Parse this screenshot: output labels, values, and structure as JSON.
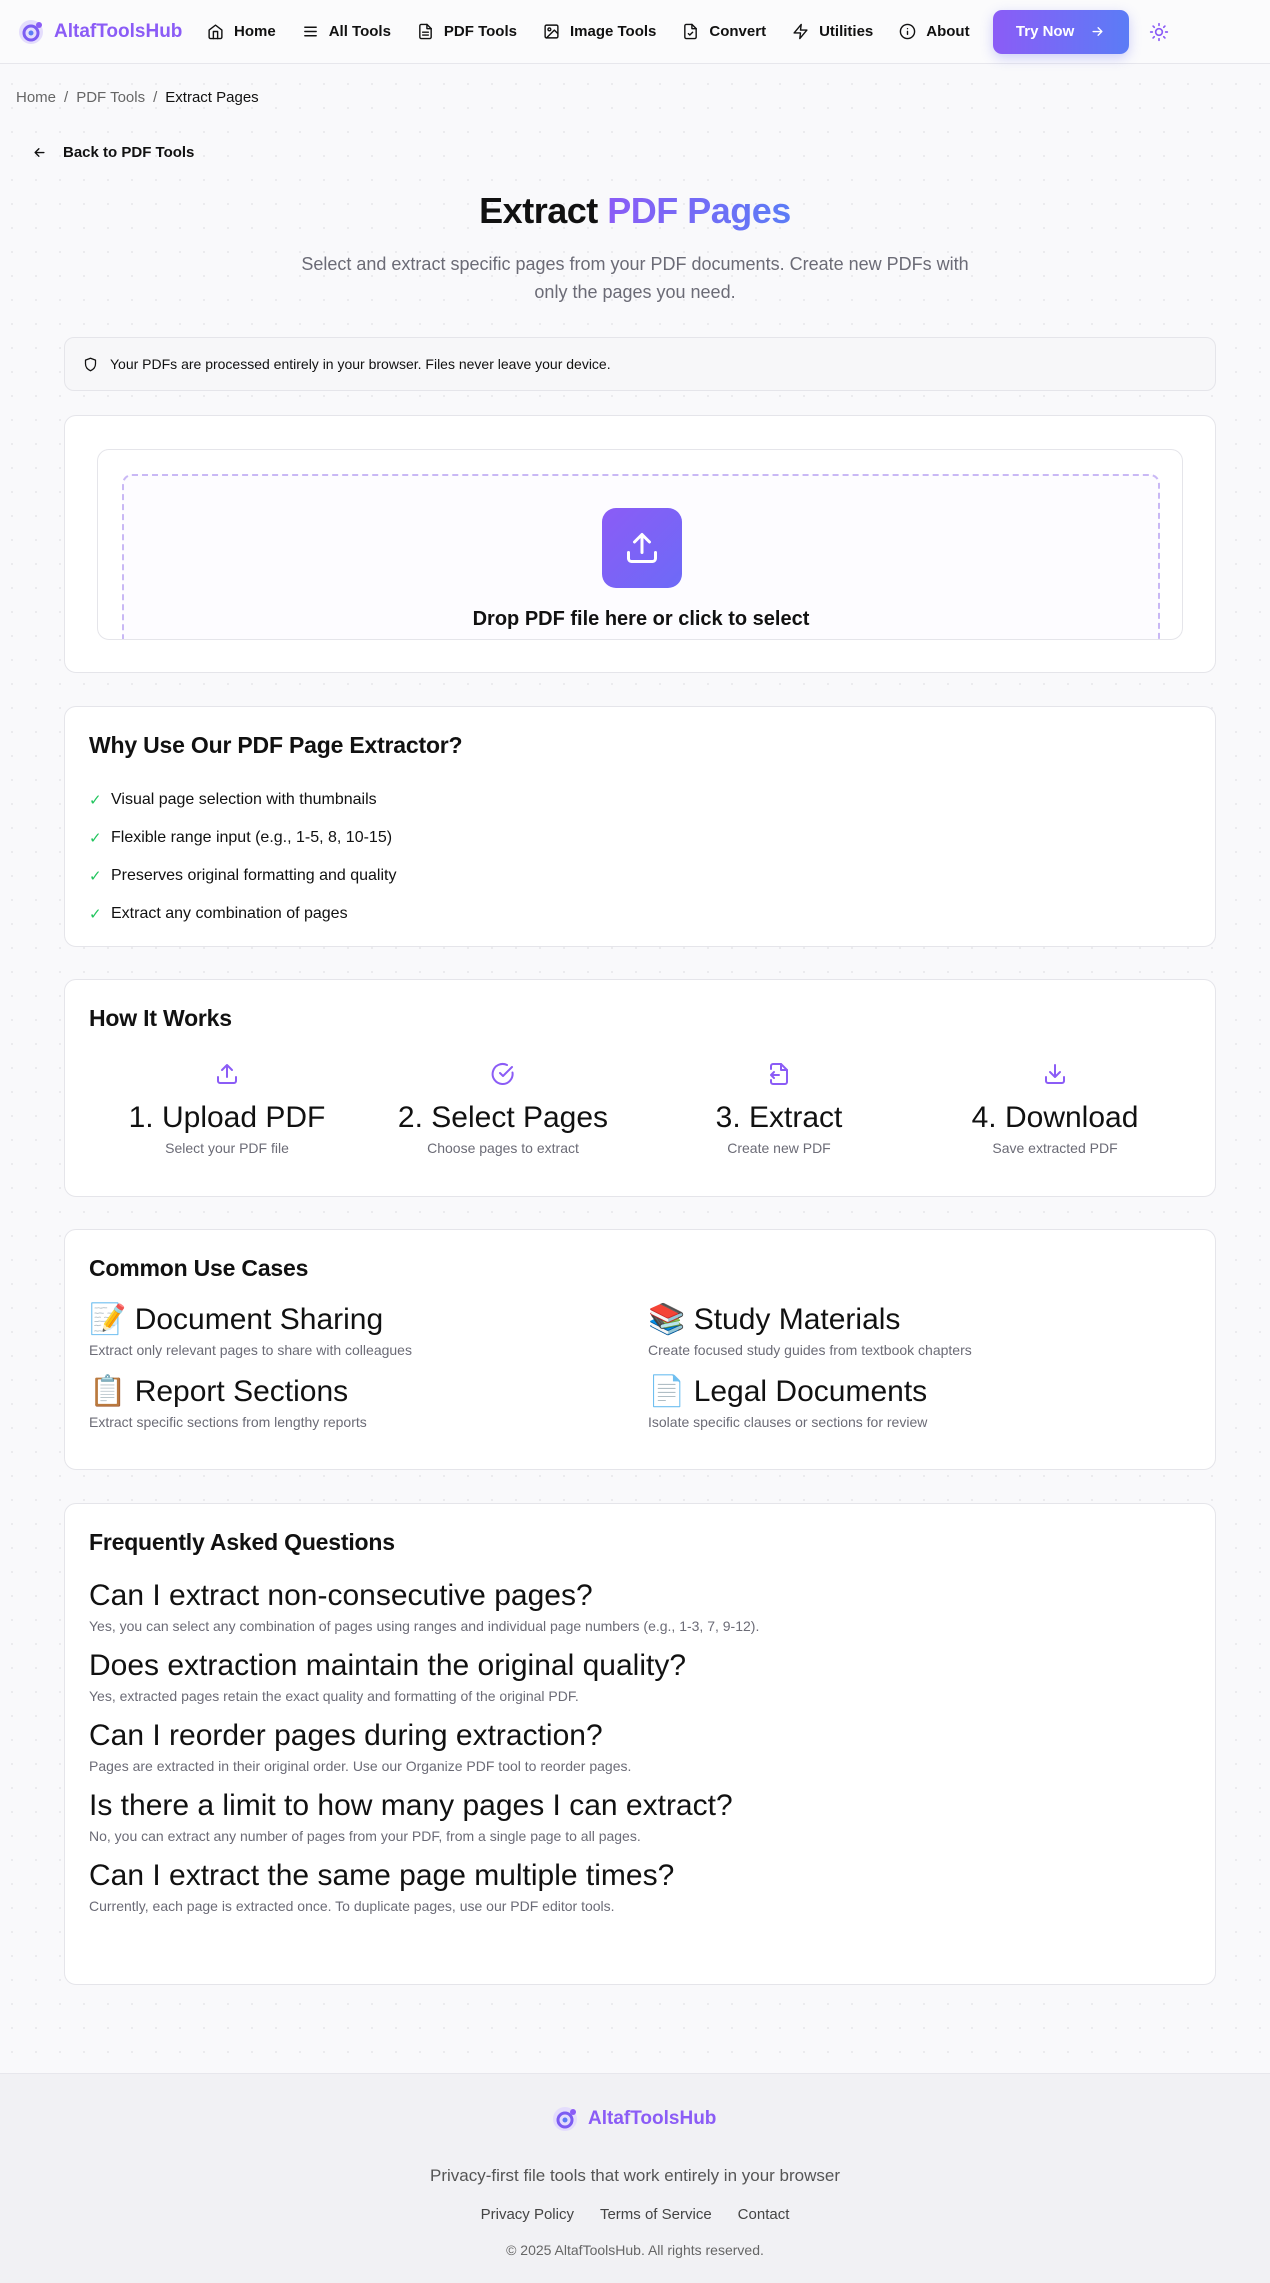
{
  "brand": {
    "name": "AltafToolsHub",
    "accent": "#8b5cf6",
    "accent2": "#5b7cf6"
  },
  "nav": {
    "items": [
      {
        "label": "Home",
        "icon": "home-icon"
      },
      {
        "label": "All Tools",
        "icon": "menu-icon"
      },
      {
        "label": "PDF Tools",
        "icon": "file-text-icon"
      },
      {
        "label": "Image Tools",
        "icon": "image-icon"
      },
      {
        "label": "Convert",
        "icon": "file-convert-icon"
      },
      {
        "label": "Utilities",
        "icon": "zap-icon"
      },
      {
        "label": "About",
        "icon": "info-icon"
      }
    ],
    "cta": "Try Now"
  },
  "breadcrumb": {
    "home": "Home",
    "sep": "/",
    "parent": "PDF Tools",
    "current": "Extract Pages"
  },
  "back_link": "Back to PDF Tools",
  "hero": {
    "title_plain": "Extract",
    "title_accent": "PDF Pages",
    "subtitle": "Select and extract specific pages from your PDF documents. Create new PDFs with only the pages you need."
  },
  "privacy_notice": "Your PDFs are processed entirely in your browser. Files never leave your device.",
  "upload": {
    "prompt": "Drop PDF file here or click to select"
  },
  "why": {
    "title": "Why Use Our PDF Page Extractor?",
    "items": [
      "Visual page selection with thumbnails",
      "Flexible range input (e.g., 1-5, 8, 10-15)",
      "Preserves original formatting and quality",
      "Extract any combination of pages"
    ],
    "check": "✓"
  },
  "how": {
    "title": "How It Works",
    "steps": [
      {
        "title": "1. Upload PDF",
        "desc": "Select your PDF file",
        "icon": "upload-icon"
      },
      {
        "title": "2. Select Pages",
        "desc": "Choose pages to extract",
        "icon": "check-circle-icon"
      },
      {
        "title": "3. Extract",
        "desc": "Create new PDF",
        "icon": "file-export-icon"
      },
      {
        "title": "4. Download",
        "desc": "Save extracted PDF",
        "icon": "download-icon"
      }
    ]
  },
  "use_cases": {
    "title": "Common Use Cases",
    "items": [
      {
        "title": "📝 Document Sharing",
        "desc": "Extract only relevant pages to share with colleagues"
      },
      {
        "title": "📚 Study Materials",
        "desc": "Create focused study guides from textbook chapters"
      },
      {
        "title": "📋 Report Sections",
        "desc": "Extract specific sections from lengthy reports"
      },
      {
        "title": "📄 Legal Documents",
        "desc": "Isolate specific clauses or sections for review"
      }
    ]
  },
  "faq": {
    "title": "Frequently Asked Questions",
    "items": [
      {
        "q": "Can I extract non-consecutive pages?",
        "a": "Yes, you can select any combination of pages using ranges and individual page numbers (e.g., 1-3, 7, 9-12)."
      },
      {
        "q": "Does extraction maintain the original quality?",
        "a": "Yes, extracted pages retain the exact quality and formatting of the original PDF."
      },
      {
        "q": "Can I reorder pages during extraction?",
        "a": "Pages are extracted in their original order. Use our Organize PDF tool to reorder pages."
      },
      {
        "q": "Is there a limit to how many pages I can extract?",
        "a": "No, you can extract any number of pages from your PDF, from a single page to all pages."
      },
      {
        "q": "Can I extract the same page multiple times?",
        "a": "Currently, each page is extracted once. To duplicate pages, use our PDF editor tools."
      }
    ]
  },
  "footer": {
    "tagline": "Privacy-first file tools that work entirely in your browser",
    "links": [
      "Privacy Policy",
      "Terms of Service",
      "Contact"
    ],
    "copyright": "© 2025 AltafToolsHub. All rights reserved."
  }
}
